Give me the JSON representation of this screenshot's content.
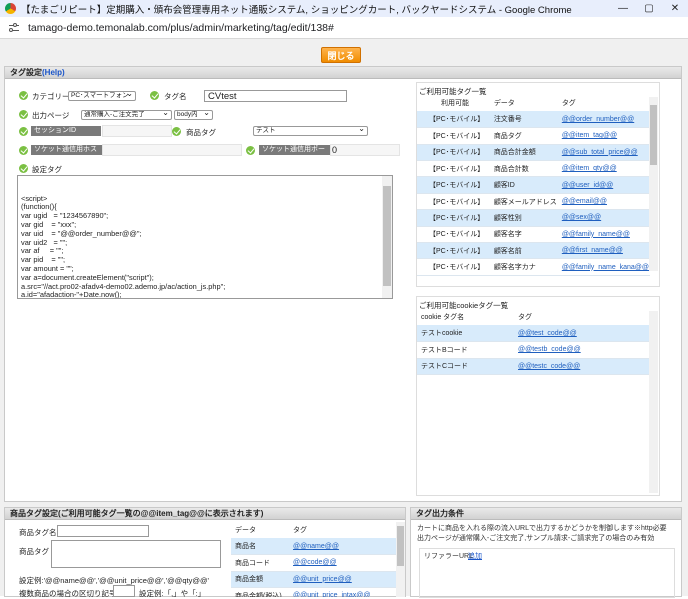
{
  "window": {
    "title": "【たまごリピート】定期購入・頒布会管理専用ネット通販システム, ショッピングカート, バックヤードシステム - Google Chrome",
    "url": "tamago-demo.temonalab.com/plus/admin/marketing/tag/edit/138#",
    "minimize": "—",
    "restore": "▢",
    "close": "✕"
  },
  "close_button": "閉じる",
  "tag_settings": {
    "heading": "タグ設定",
    "help": "(Help)",
    "category_label": "カテゴリー",
    "category_value": "PC･スマートフォン",
    "tag_name_label": "タグ名",
    "tag_name_value": "CVtest",
    "output_page_label": "出力ページ",
    "output_page_value": "通常購入-ご注文完了",
    "output_position_value": "body内",
    "session_id_label": "セッションID",
    "product_tag_label": "商品タグ",
    "product_tag_value": "テスト",
    "socket_host_label": "ソケット通信用ホスト",
    "socket_port_label": "ソケット通信用ポート",
    "socket_port_value": "0",
    "setting_tag_label": "設定タグ",
    "code_lines": [
      "<script>",
      "(function(){",
      "var ugid   = \"1234567890\";",
      "var gid    = \"xxx\";",
      "var uid    = \"@@order_number@@\";",
      "var uid2   = \"\";",
      "var af     = \"\";",
      "var pid    = \"\";",
      "var amount = \"\";",
      "var a=document.createElement(\"script\");",
      "a.src=\"//act.pro02-afadv4-demo02.ademo.jp/ac/action_js.php\";",
      "a.id=\"afadaction-\"+Date.now();",
      "a.addEventListener(\"load\",function(){(new fpcAction(a.id)).groupAction(gid, af, [uid, uid2], pid,",
      "amount, ugid)});",
      "document.head.appendChild(a)})();"
    ]
  },
  "available_tags": {
    "heading": "ご利用可能タグ一覧",
    "columns": [
      "利用可能",
      "データ",
      "タグ"
    ],
    "rows": [
      {
        "env": "【PC･モバイル】",
        "data": "注文番号",
        "tag": "@@order_number@@"
      },
      {
        "env": "【PC･モバイル】",
        "data": "商品タグ",
        "tag": "@@item_tag@@"
      },
      {
        "env": "【PC･モバイル】",
        "data": "商品合計金額",
        "tag": "@@sub_total_price@@"
      },
      {
        "env": "【PC･モバイル】",
        "data": "商品合計数",
        "tag": "@@item_qty@@"
      },
      {
        "env": "【PC･モバイル】",
        "data": "顧客ID",
        "tag": "@@user_id@@"
      },
      {
        "env": "【PC･モバイル】",
        "data": "顧客メールアドレス",
        "tag": "@@email@@"
      },
      {
        "env": "【PC･モバイル】",
        "data": "顧客性別",
        "tag": "@@sex@@"
      },
      {
        "env": "【PC･モバイル】",
        "data": "顧客名字",
        "tag": "@@family_name@@"
      },
      {
        "env": "【PC･モバイル】",
        "data": "顧客名前",
        "tag": "@@first_name@@"
      },
      {
        "env": "【PC･モバイル】",
        "data": "顧客名字カナ",
        "tag": "@@family_name_kana@@"
      }
    ]
  },
  "cookie_tags": {
    "heading": "ご利用可能cookieタグ一覧",
    "columns": [
      "cookie タグ名",
      "タグ"
    ],
    "rows": [
      {
        "name": "テストcookie",
        "tag": "@@test_code@@"
      },
      {
        "name": "テストBコード",
        "tag": "@@testb_code@@"
      },
      {
        "name": "テストCコード",
        "tag": "@@testc_code@@"
      }
    ]
  },
  "product_tag_settings": {
    "heading": "商品タグ設定(ご利用可能タグ一覧の@@item_tag@@に表示されます)",
    "tag_name_label": "商品タグ名",
    "tag_label": "商品タグ",
    "example": "設定例:'@@name@@','@@unit_price@@','@@qty@@'",
    "multi_label": "複数商品の場合の区切り記号",
    "multi_example": "設定例:「,」や「:」",
    "columns": [
      "データ",
      "タグ"
    ],
    "rows": [
      {
        "data": "商品名",
        "tag": "@@name@@"
      },
      {
        "data": "商品コード",
        "tag": "@@code@@"
      },
      {
        "data": "商品金額",
        "tag": "@@unit_price@@"
      },
      {
        "data": "商品金額(税込)",
        "tag": "@@unit_price_intax@@"
      }
    ]
  },
  "output_conditions": {
    "heading": "タグ出力条件",
    "line1": "カートに商品を入れる際の流入URLで出力するかどうかを制御します※http必要",
    "line2": "出力ページが通常購入-ご注文完了,サンプル請求-ご請求完了の場合のみ有効",
    "referrer_label": "リファラーURL",
    "add_link": "追加"
  }
}
